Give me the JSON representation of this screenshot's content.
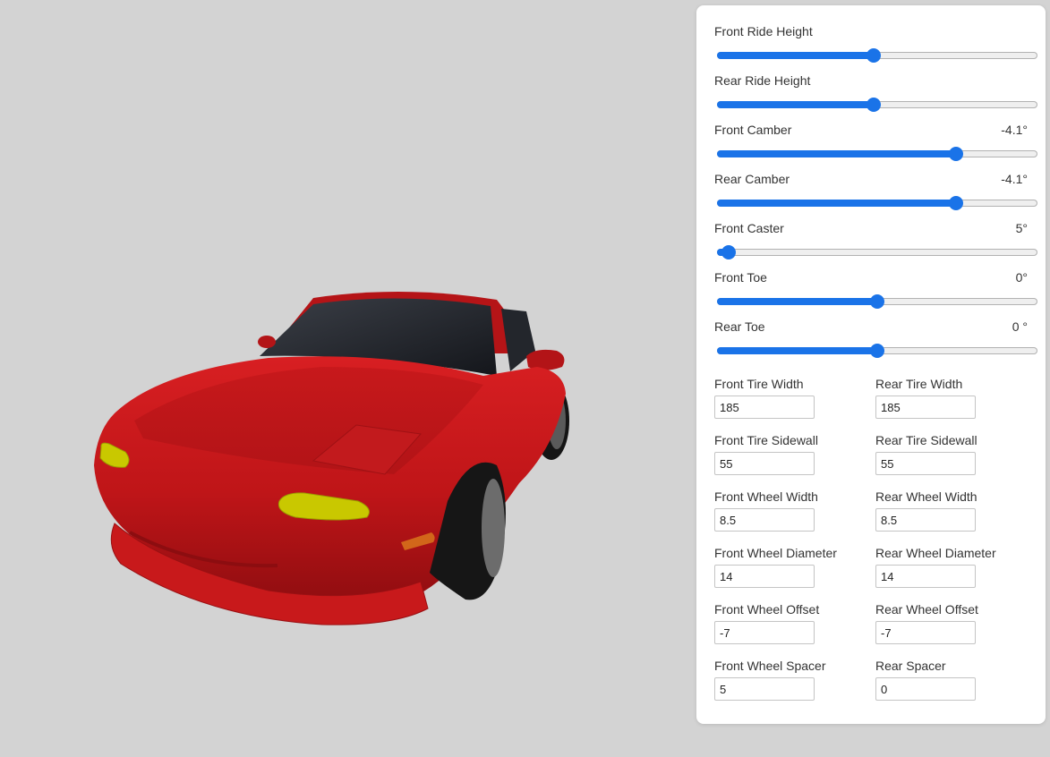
{
  "scene": {
    "background": "#d3d3d3",
    "car_color": "#c8191b",
    "headlight_color": "#c9c800",
    "tire_color": "#161616"
  },
  "sliders": [
    {
      "label": "Front Ride Height",
      "value": "",
      "level": 0.49
    },
    {
      "label": "Rear Ride Height",
      "value": "",
      "level": 0.49
    },
    {
      "label": "Front Camber",
      "value": "-4.1°",
      "level": 0.745
    },
    {
      "label": "Rear Camber",
      "value": "-4.1°",
      "level": 0.745
    },
    {
      "label": "Front Caster",
      "value": "5°",
      "level": 0.035
    },
    {
      "label": "Front Toe",
      "value": "0°",
      "level": 0.5
    },
    {
      "label": "Rear Toe",
      "value": "0 °",
      "level": 0.5
    }
  ],
  "fields": [
    [
      {
        "label": "Front Tire Width",
        "value": "185"
      },
      {
        "label": "Rear Tire Width",
        "value": "185"
      }
    ],
    [
      {
        "label": "Front Tire Sidewall",
        "value": "55"
      },
      {
        "label": "Rear Tire Sidewall",
        "value": "55"
      }
    ],
    [
      {
        "label": "Front Wheel Width",
        "value": "8.5"
      },
      {
        "label": "Rear Wheel Width",
        "value": "8.5"
      }
    ],
    [
      {
        "label": "Front Wheel Diameter",
        "value": "14"
      },
      {
        "label": "Rear Wheel Diameter",
        "value": "14"
      }
    ],
    [
      {
        "label": "Front Wheel Offset",
        "value": "-7"
      },
      {
        "label": "Rear Wheel Offset",
        "value": "-7"
      }
    ],
    [
      {
        "label": "Front Wheel Spacer",
        "value": "5"
      },
      {
        "label": "Rear Spacer",
        "value": "0"
      }
    ]
  ]
}
